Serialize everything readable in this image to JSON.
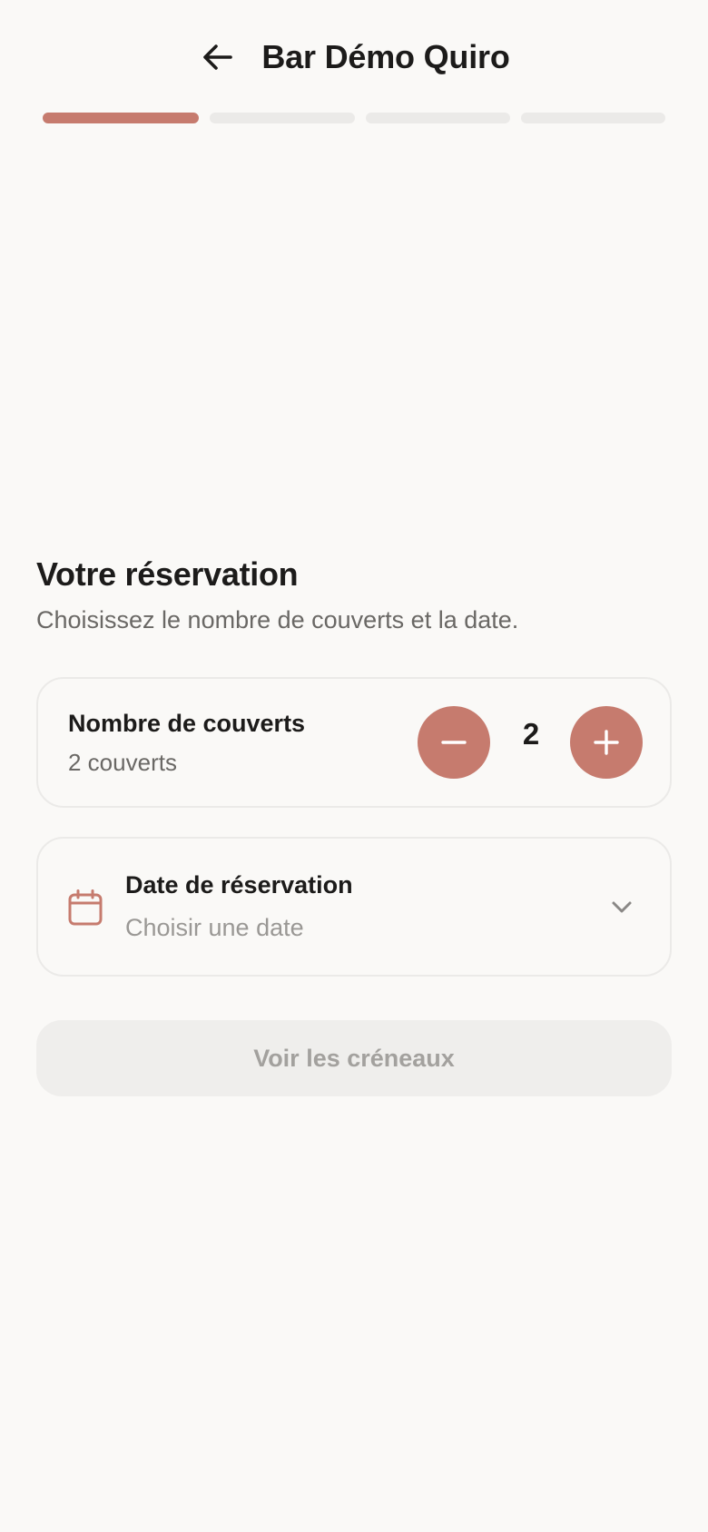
{
  "header": {
    "title": "Bar Démo Quiro",
    "back_icon": "arrow-left-icon"
  },
  "progress": {
    "total_steps": 4,
    "current_step": 1,
    "active_color": "#c67b6e",
    "inactive_color": "#ebeae8"
  },
  "reservation": {
    "title": "Votre réservation",
    "subtitle": "Choisissez le nombre de couverts et la date."
  },
  "guests": {
    "label": "Nombre de couverts",
    "summary": "2 couverts",
    "value": "2",
    "minus_icon": "minus-icon",
    "plus_icon": "plus-icon",
    "accent_color": "#c67b6e"
  },
  "date": {
    "label": "Date de réservation",
    "placeholder": "Choisir une date",
    "icon": "calendar-icon",
    "chevron_icon": "chevron-down-icon"
  },
  "cta": {
    "label": "Voir les créneaux",
    "disabled": true
  }
}
